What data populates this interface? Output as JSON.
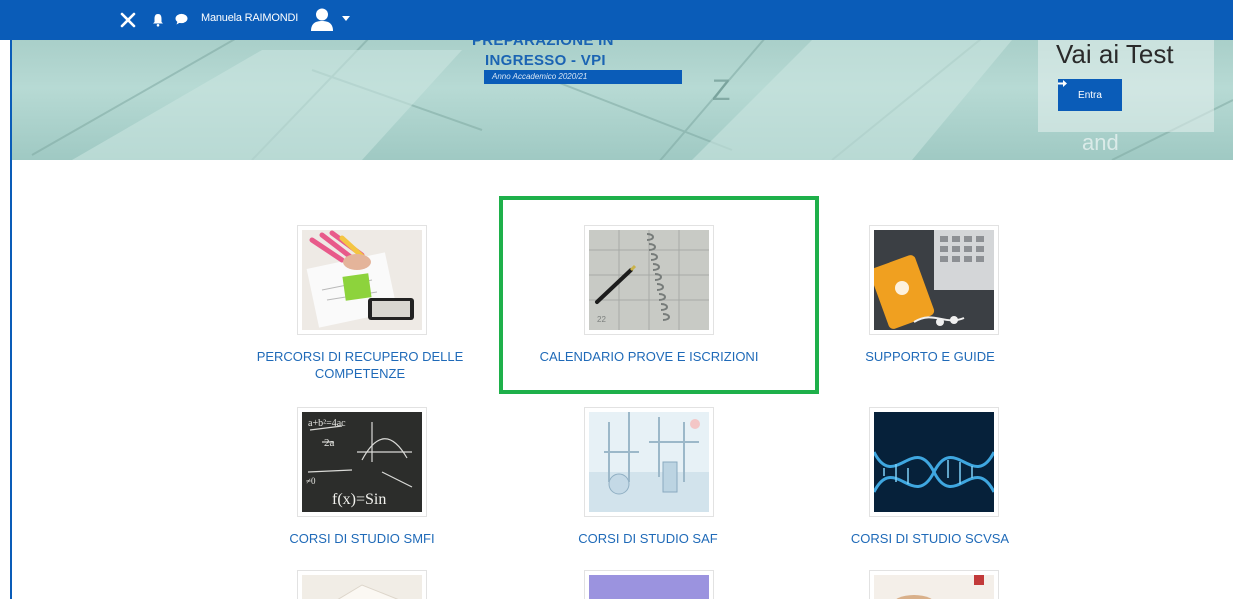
{
  "topbar": {
    "user_name": "Manuela RAIMONDI",
    "icons": [
      "close-icon",
      "bell-icon",
      "chat-icon",
      "user-avatar-icon",
      "caret-down-icon"
    ]
  },
  "banner": {
    "title_top": "PREPARAZIONE IN",
    "title": "INGRESSO - VPI",
    "subtitle": "Anno Accademico 2020/21",
    "test_title": "Vai ai Test",
    "enter_label": "Entra"
  },
  "tiles": [
    {
      "label": "PERCORSI DI RECUPERO DELLE COMPETENZE",
      "image": "student-writing-image"
    },
    {
      "label": "CALENDARIO PROVE E ISCRIZIONI",
      "image": "calendar-notebook-image"
    },
    {
      "label": "SUPPORTO E GUIDE",
      "image": "phone-keyboard-image"
    },
    {
      "label": "CORSI DI STUDIO SMFI",
      "image": "blackboard-math-image"
    },
    {
      "label": "CORSI DI STUDIO SAF",
      "image": "laboratory-image"
    },
    {
      "label": "CORSI DI STUDIO SCVSA",
      "image": "dna-helix-image"
    }
  ],
  "colors": {
    "topbar": "#0a5cb8",
    "link": "#1f6ab8",
    "highlight": "#1eb04a"
  }
}
